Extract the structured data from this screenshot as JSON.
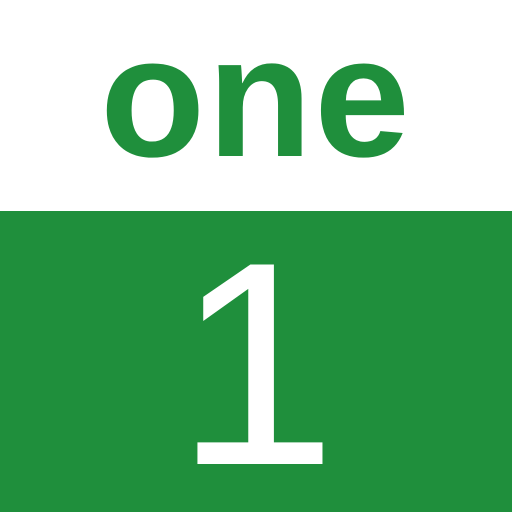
{
  "tile": {
    "word": "one",
    "numeral": "1"
  },
  "colors": {
    "accent": "#1f8f3c",
    "background": "#ffffff",
    "numeral_text": "#ffffff"
  }
}
